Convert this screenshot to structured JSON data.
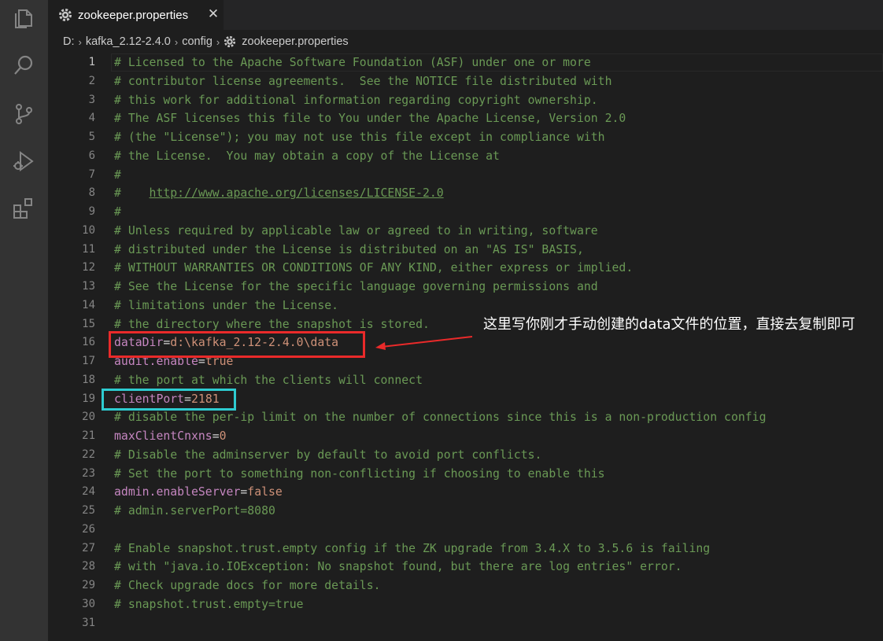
{
  "tab": {
    "label": "zookeeper.properties",
    "close": "✕"
  },
  "breadcrumb": {
    "items": [
      "D:",
      "kafka_2.12-2.4.0",
      "config",
      "zookeeper.properties"
    ],
    "separator": "›"
  },
  "annotation": {
    "text": "这里写你刚才手动创建的data文件的位置，直接去复制即可"
  },
  "colors": {
    "comment": "#6a9955",
    "property_key": "#c586c0",
    "property_value": "#ce9178",
    "highlight_red": "#ea2a2a",
    "highlight_cyan": "#2ecbd0"
  },
  "active_line": 1,
  "editor": {
    "lines": [
      {
        "n": "1",
        "type": "comment",
        "text": "# Licensed to the Apache Software Foundation (ASF) under one or more"
      },
      {
        "n": "2",
        "type": "comment",
        "text": "# contributor license agreements.  See the NOTICE file distributed with"
      },
      {
        "n": "3",
        "type": "comment",
        "text": "# this work for additional information regarding copyright ownership."
      },
      {
        "n": "4",
        "type": "comment",
        "text": "# The ASF licenses this file to You under the Apache License, Version 2.0"
      },
      {
        "n": "5",
        "type": "comment",
        "text": "# (the \"License\"); you may not use this file except in compliance with"
      },
      {
        "n": "6",
        "type": "comment",
        "text": "# the License.  You may obtain a copy of the License at"
      },
      {
        "n": "7",
        "type": "comment",
        "text": "#"
      },
      {
        "n": "8",
        "type": "link",
        "prefix": "#    ",
        "link": "http://www.apache.org/licenses/LICENSE-2.0"
      },
      {
        "n": "9",
        "type": "comment",
        "text": "#"
      },
      {
        "n": "10",
        "type": "comment",
        "text": "# Unless required by applicable law or agreed to in writing, software"
      },
      {
        "n": "11",
        "type": "comment",
        "text": "# distributed under the License is distributed on an \"AS IS\" BASIS,"
      },
      {
        "n": "12",
        "type": "comment",
        "text": "# WITHOUT WARRANTIES OR CONDITIONS OF ANY KIND, either express or implied."
      },
      {
        "n": "13",
        "type": "comment",
        "text": "# See the License for the specific language governing permissions and"
      },
      {
        "n": "14",
        "type": "comment",
        "text": "# limitations under the License."
      },
      {
        "n": "15",
        "type": "comment",
        "text": "# the directory where the snapshot is stored."
      },
      {
        "n": "16",
        "type": "prop",
        "key": "dataDir",
        "value": "d:\\kafka_2.12-2.4.0\\data"
      },
      {
        "n": "17",
        "type": "prop",
        "key": "audit.enable",
        "value": "true"
      },
      {
        "n": "18",
        "type": "comment",
        "text": "# the port at which the clients will connect"
      },
      {
        "n": "19",
        "type": "prop",
        "key": "clientPort",
        "value": "2181"
      },
      {
        "n": "20",
        "type": "comment",
        "text": "# disable the per-ip limit on the number of connections since this is a non-production config"
      },
      {
        "n": "21",
        "type": "prop",
        "key": "maxClientCnxns",
        "value": "0"
      },
      {
        "n": "22",
        "type": "comment",
        "text": "# Disable the adminserver by default to avoid port conflicts."
      },
      {
        "n": "23",
        "type": "comment",
        "text": "# Set the port to something non-conflicting if choosing to enable this"
      },
      {
        "n": "24",
        "type": "prop",
        "key": "admin.enableServer",
        "value": "false"
      },
      {
        "n": "25",
        "type": "comment",
        "text": "# admin.serverPort=8080"
      },
      {
        "n": "26",
        "type": "blank",
        "text": ""
      },
      {
        "n": "27",
        "type": "comment",
        "text": "# Enable snapshot.trust.empty config if the ZK upgrade from 3.4.X to 3.5.6 is failing"
      },
      {
        "n": "28",
        "type": "comment",
        "text": "# with \"java.io.IOException: No snapshot found, but there are log entries\" error."
      },
      {
        "n": "29",
        "type": "comment",
        "text": "# Check upgrade docs for more details."
      },
      {
        "n": "30",
        "type": "comment",
        "text": "# snapshot.trust.empty=true"
      },
      {
        "n": "31",
        "type": "blank",
        "text": ""
      }
    ]
  }
}
